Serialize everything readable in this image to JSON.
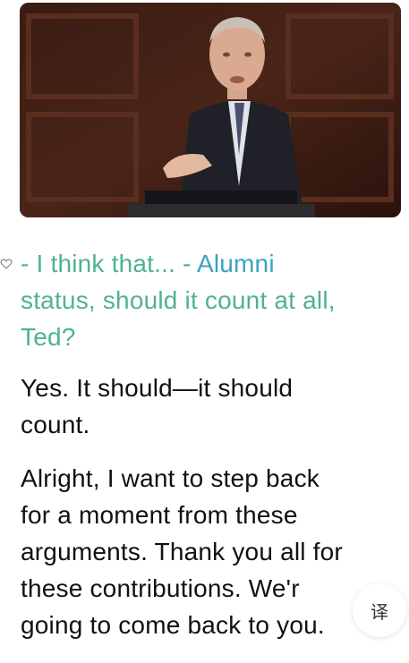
{
  "transcript": {
    "current": {
      "line1_part1": "- I think that... - ",
      "line1_part2": "Alumni",
      "line2": "status, should it count at all,",
      "line3": "Ted?"
    },
    "p2": {
      "line1": "Yes. It should—it should",
      "line2": "count."
    },
    "p3": {
      "line1": "Alright, I want to step back",
      "line2": "for a moment from these",
      "line3": "arguments. Thank you all for",
      "line4": "these contributions. We'r",
      "line5": "going to come back to you."
    }
  },
  "controls": {
    "translate_label": "译"
  },
  "colors": {
    "current_text": "#4fb38c",
    "highlight_text": "#3aa3c4",
    "body_text": "#111111"
  },
  "icons": {
    "bookmark": "heart-outline-icon",
    "translate": "translate-icon"
  }
}
